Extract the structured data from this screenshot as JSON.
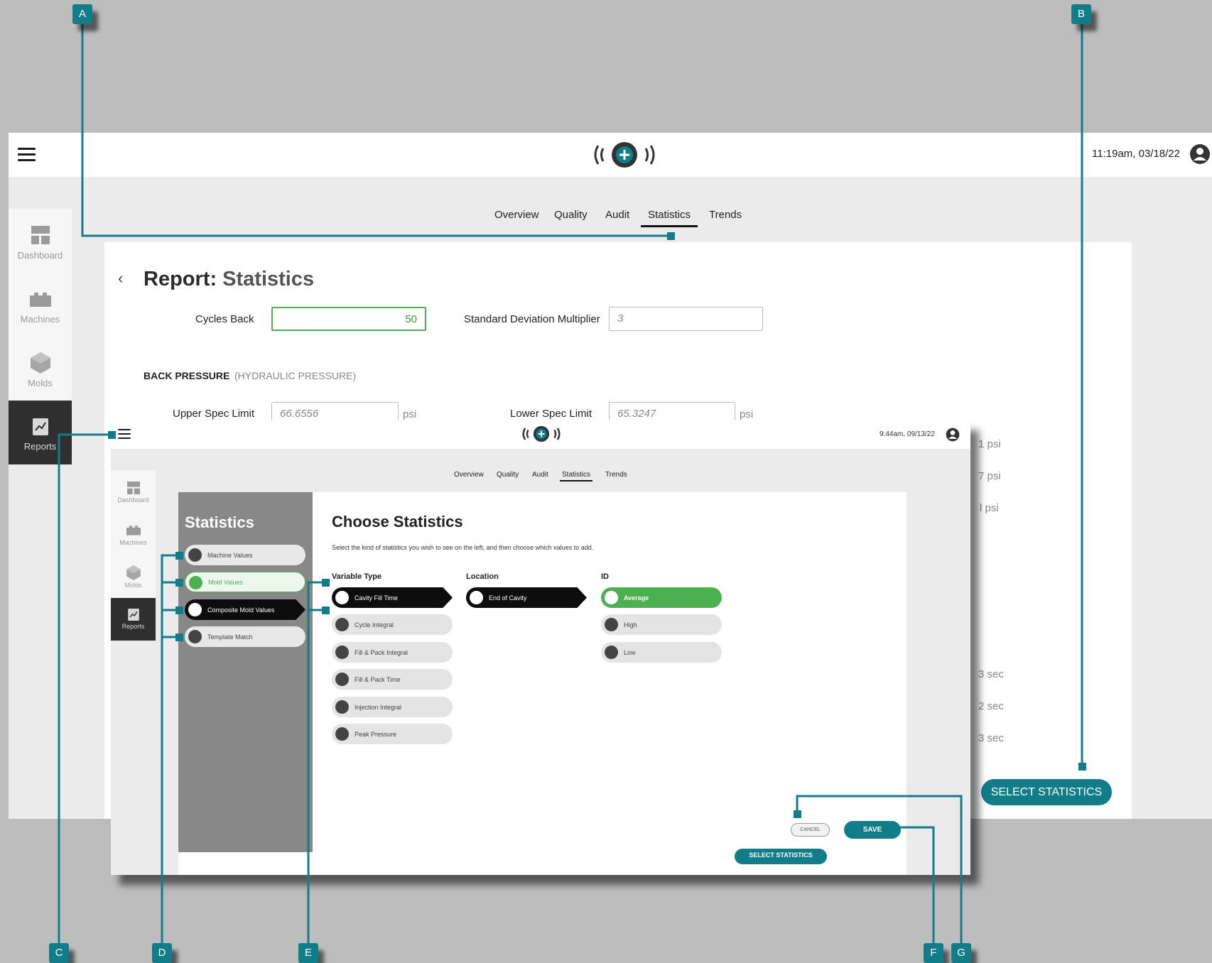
{
  "main": {
    "clock": "11:19am, 03/18/22",
    "tabs": [
      "Overview",
      "Quality",
      "Audit",
      "Statistics",
      "Trends"
    ],
    "active_tab": "Statistics",
    "sidebar": [
      "Dashboard",
      "Machines",
      "Molds",
      "Reports"
    ],
    "active_sidebar": "Reports",
    "title_prefix": "Report:",
    "title_sub": "Statistics",
    "cycles_back_label": "Cycles Back",
    "cycles_back_value": "50",
    "sdm_label": "Standard Deviation Multiplier",
    "sdm_placeholder": "3",
    "section_title": "BACK PRESSURE",
    "section_sub": "(HYDRAULIC PRESSURE)",
    "usl_label": "Upper Spec Limit",
    "usl_value": "66.6556",
    "lsl_label": "Lower Spec Limit",
    "lsl_value": "65.3247",
    "unit_psi": "psi",
    "partial_right": [
      "1 psi",
      "7 psi",
      "l psi",
      "3 sec",
      "2 sec",
      "3 sec"
    ],
    "select_statistics": "SELECT STATISTICS"
  },
  "inset": {
    "clock": "9:44am, 09/13/22",
    "tabs": [
      "Overview",
      "Quality",
      "Audit",
      "Statistics",
      "Trends"
    ],
    "active_tab": "Statistics",
    "sidebar": [
      "Dashboard",
      "Machines",
      "Molds",
      "Reports"
    ],
    "panel_title": "Statistics",
    "categories": [
      "Machine Values",
      "Mold Values",
      "Composite Mold Values",
      "Template Match"
    ],
    "choose_title": "Choose Statistics",
    "choose_desc": "Select the kind of statistics you wish to see on the left, and then choose which values to add.",
    "col_variable": "Variable Type",
    "col_location": "Location",
    "col_id": "ID",
    "variables": [
      "Cavity Fill Time",
      "Cycle Integral",
      "Fill & Pack Integral",
      "Fill & Pack Time",
      "Injection Integral",
      "Peak Pressure"
    ],
    "locations": [
      "End of Cavity"
    ],
    "ids": [
      "Average",
      "High",
      "Low"
    ],
    "cancel": "CANCEL",
    "save": "SAVE",
    "select_statistics": "SELECT STATISTICS"
  },
  "callouts": [
    "A",
    "B",
    "C",
    "D",
    "E",
    "F",
    "G"
  ],
  "colors": {
    "accent": "#117d89",
    "green": "#4caf50",
    "dark": "#0d0d0d"
  }
}
